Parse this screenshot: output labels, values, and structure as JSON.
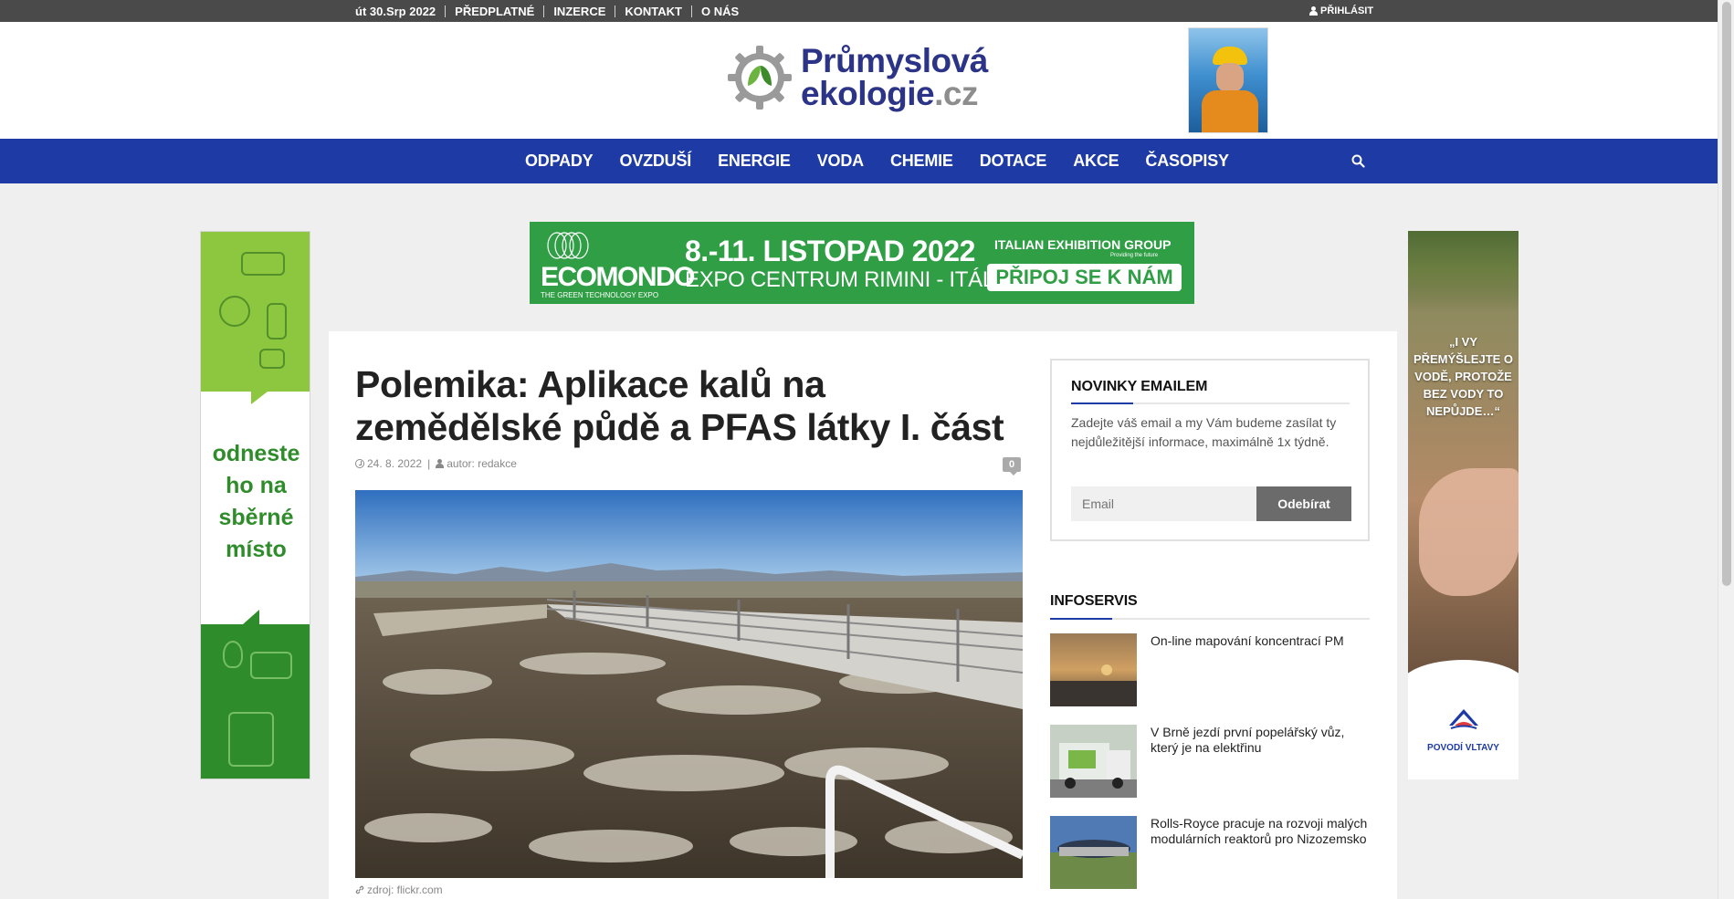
{
  "topbar": {
    "date": "út 30.Srp 2022",
    "links": [
      "PŘEDPLATNÉ",
      "INZERCE",
      "KONTAKT",
      "O NÁS"
    ],
    "login": "PŘIHLÁSIT"
  },
  "logo": {
    "line1": "Průmyslová",
    "line2": "ekologie",
    "tld": ".cz"
  },
  "nav": {
    "items": [
      "ODPADY",
      "OVZDUŠÍ",
      "ENERGIE",
      "VODA",
      "CHEMIE",
      "DOTACE",
      "AKCE",
      "ČASOPISY"
    ]
  },
  "banner_left": {
    "message": "odneste ho na sběrné místo"
  },
  "banner_right": {
    "quote": "„I VY PŘEMÝŠLEJTE O VODĚ, PROTOŽE BEZ VODY TO NEPŮJDE…“",
    "brand": "POVODÍ VLTAVY"
  },
  "ecomondo": {
    "brand": "ECOMONDO",
    "sub": "THE GREEN TECHNOLOGY EXPO",
    "date": "8.-11. LISTOPAD 2022",
    "place": "EXPO CENTRUM RIMINI - ITÁLIE",
    "organizer": "ITALIAN EXHIBITION GROUP",
    "organizer_sub": "Providing the future",
    "cta": "PŘIPOJ SE K NÁM"
  },
  "article": {
    "title": "Polemika: Aplikace kalů na zemědělské půdě a PFAS látky I. část",
    "date": "24. 8. 2022",
    "author": "autor: redakce",
    "comments": "0",
    "source": "zdroj: flickr.com"
  },
  "newsletter": {
    "heading": "NOVINKY EMAILEM",
    "description": "Zadejte váš email a my Vám budeme zasílat ty nejdůležitější informace, maximálně 1x týdně.",
    "email_placeholder": "Email",
    "button": "Odebírat"
  },
  "infoservis": {
    "heading": "INFOSERVIS",
    "items": [
      {
        "title": "On-line mapování koncentrací PM"
      },
      {
        "title": "V Brně jezdí první popelářský vůz, který je na elektřinu"
      },
      {
        "title": "Rolls-Royce pracuje na rozvoji malých modulárních reaktorů pro Nizozemsko"
      }
    ]
  },
  "colors": {
    "topbar": "#4a4a4a",
    "nav": "#1e3aa5",
    "brand_blue": "#2c3488",
    "green": "#2f9e44"
  }
}
